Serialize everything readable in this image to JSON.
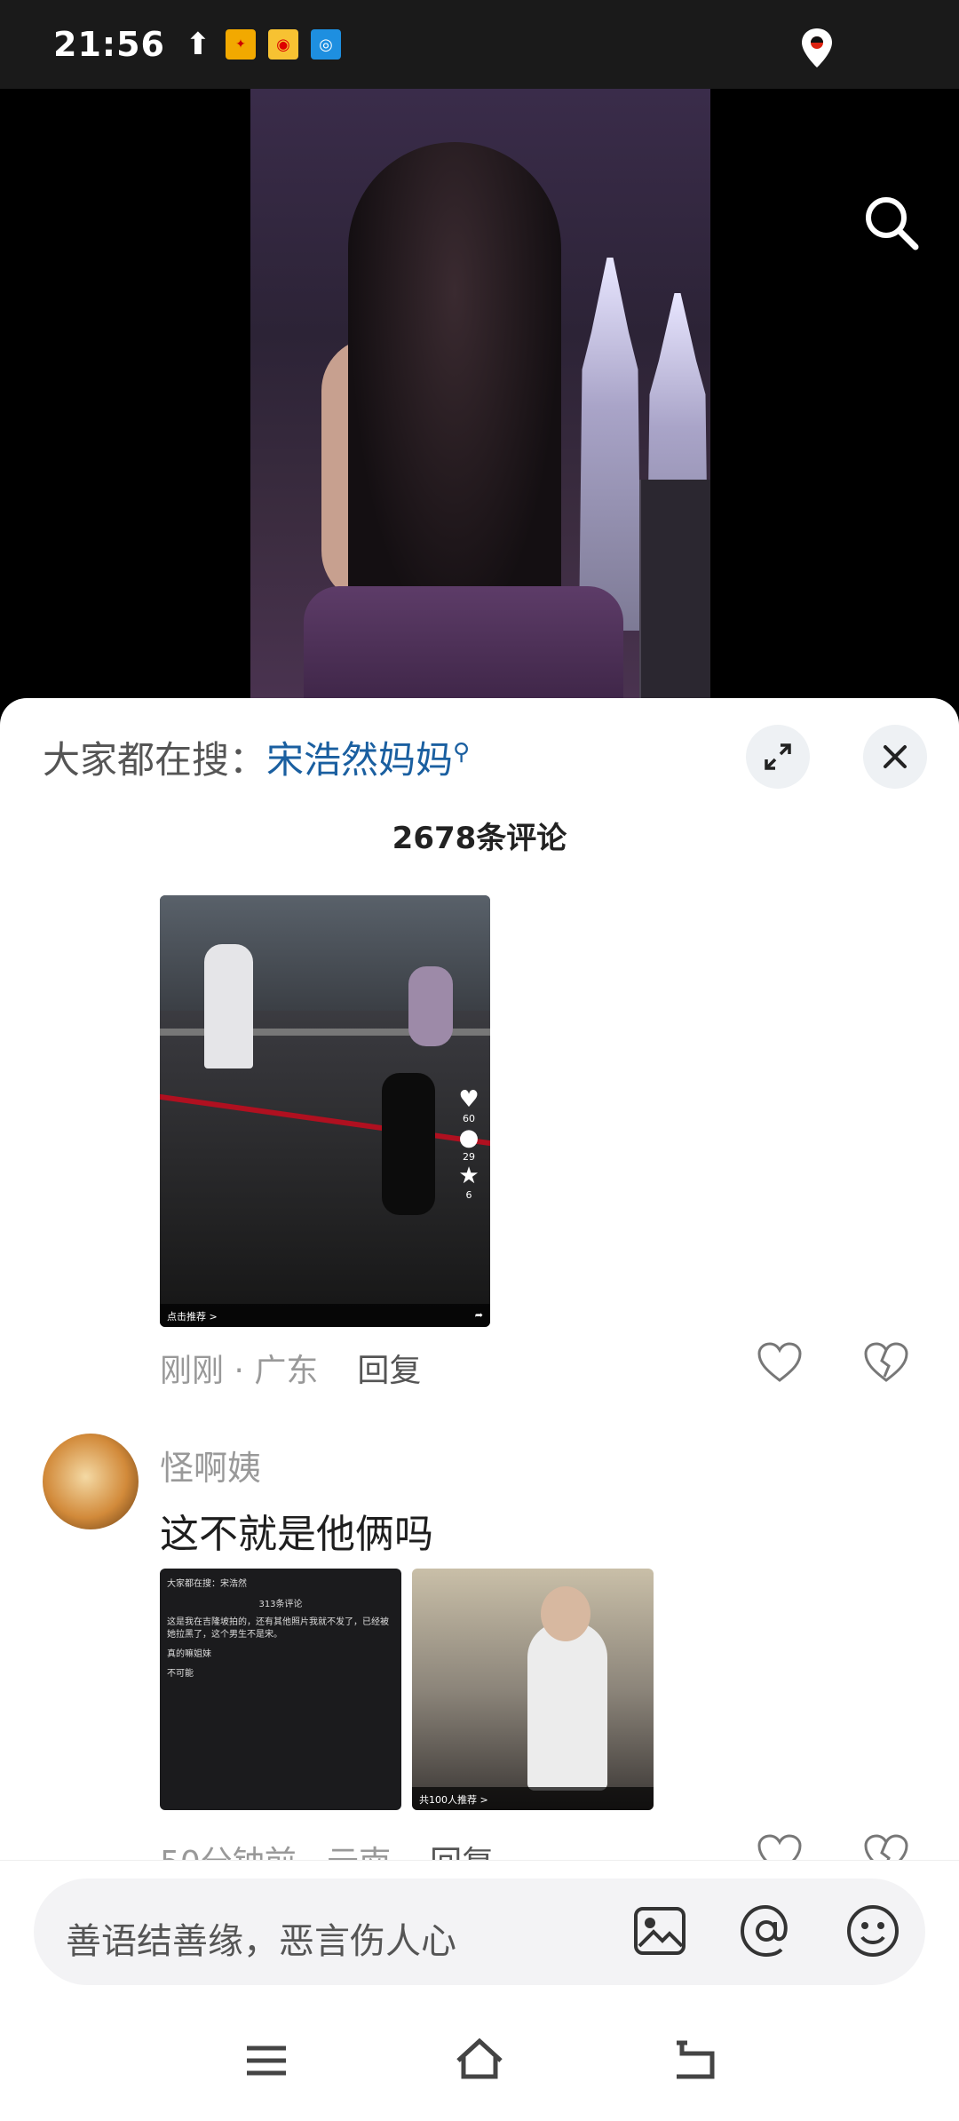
{
  "status_bar": {
    "time": "21:56",
    "icons": [
      "upload-icon",
      "sohu-app-icon",
      "weibo-app-icon",
      "hotspot-icon",
      "location-pin-icon"
    ]
  },
  "video": {
    "search_icon": "search-icon"
  },
  "sheet": {
    "hot_search_label": "大家都在搜：",
    "hot_search_term": "宋浩然妈妈",
    "comment_count": "2678条评论",
    "expand_icon": "expand-icon",
    "close_icon": "close-icon"
  },
  "comments": [
    {
      "thumb_side": {
        "likes": "60",
        "comments": "29",
        "stars": "6"
      },
      "thumb_footer": "点击推荐 >",
      "time_location": "刚刚 · 广东",
      "reply_label": "回复"
    },
    {
      "user": "怪啊姨",
      "text": "这不就是他俩吗",
      "thumb_a": {
        "header": "大家都在搜：宋浩然",
        "count": "313条评论",
        "line1": "这是我在吉隆坡拍的，还有其他照片我就不发了，已经被她拉黑了，这个男生不是宋。",
        "line2": "真的嘛姐妹",
        "line3": "不可能"
      },
      "thumb_b": {
        "footer": "共100人推荐 >"
      },
      "time_location": "50分钟前 · 云南",
      "reply_label": "回复"
    }
  ],
  "input": {
    "placeholder": "善语结善缘，恶言伤人心"
  }
}
